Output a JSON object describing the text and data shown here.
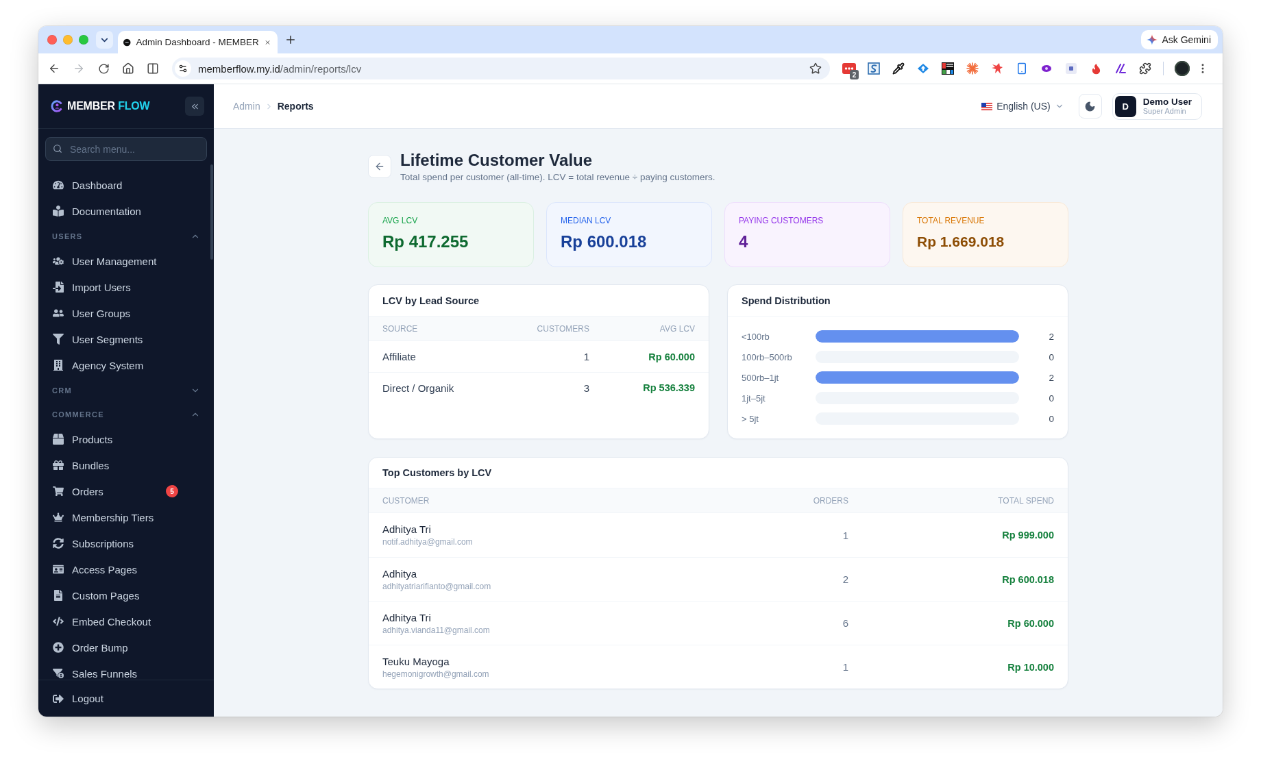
{
  "browser": {
    "tab_title": "Admin Dashboard - MEMBER",
    "forward_button": {
      "disabled": true
    },
    "url": {
      "host": "memberflow.my.id",
      "path": "/admin/reports/lcv"
    },
    "extension_badge": "2",
    "gemini_button": "Ask Gemini"
  },
  "sidebar": {
    "brand": {
      "name": "MEMBER",
      "accent": "FLOW"
    },
    "search": {
      "placeholder": "Search menu..."
    },
    "sections": [
      {
        "items": [
          {
            "label": "Dashboard",
            "selected": false
          },
          {
            "label": "Documentation",
            "selected": false
          }
        ]
      },
      {
        "heading": "USERS",
        "expanded": true,
        "items": [
          {
            "label": "User Management",
            "selected": false
          },
          {
            "label": "Import Users",
            "selected": false
          },
          {
            "label": "User Groups",
            "selected": false
          },
          {
            "label": "User Segments",
            "selected": false
          },
          {
            "label": "Agency System",
            "selected": false
          }
        ]
      },
      {
        "heading": "CRM",
        "expanded": false
      },
      {
        "heading": "COMMERCE",
        "expanded": true,
        "items": [
          {
            "label": "Products",
            "selected": false
          },
          {
            "label": "Bundles",
            "selected": false
          },
          {
            "label": "Orders",
            "selected": false,
            "badge": "5"
          },
          {
            "label": "Membership Tiers",
            "selected": false
          },
          {
            "label": "Subscriptions",
            "selected": false
          },
          {
            "label": "Access Pages",
            "selected": false
          },
          {
            "label": "Custom Pages",
            "selected": false
          },
          {
            "label": "Embed Checkout",
            "selected": false
          },
          {
            "label": "Order Bump",
            "selected": false
          },
          {
            "label": "Sales Funnels",
            "selected": false
          }
        ]
      }
    ],
    "footer": {
      "label": "Logout"
    }
  },
  "header": {
    "breadcrumb": [
      {
        "label": "Admin",
        "current": false
      },
      {
        "label": "Reports",
        "current": true
      }
    ],
    "language": "English (US)",
    "user": {
      "initial": "D",
      "name": "Demo User",
      "role": "Super Admin"
    }
  },
  "page": {
    "title": "Lifetime Customer Value",
    "subtitle": "Total spend per customer (all-time). LCV = total revenue ÷ paying customers."
  },
  "stats": [
    {
      "label": "AVG LCV",
      "value": "Rp 417.255",
      "color": "#16a34a"
    },
    {
      "label": "MEDIAN LCV",
      "value": "Rp 600.018",
      "color": "#2563eb"
    },
    {
      "label": "PAYING CUSTOMERS",
      "value": "4",
      "color": "#9333ea"
    },
    {
      "label": "TOTAL REVENUE",
      "value": "Rp 1.669.018",
      "color": "#d97706"
    }
  ],
  "lead_source": {
    "title": "LCV by Lead Source",
    "columns": [
      "SOURCE",
      "CUSTOMERS",
      "AVG LCV"
    ],
    "rows": [
      {
        "source": "Affiliate",
        "customers": "1",
        "avg_lcv": "Rp 60.000"
      },
      {
        "source": "Direct / Organik",
        "customers": "3",
        "avg_lcv": "Rp 536.339"
      }
    ]
  },
  "spend_distribution": {
    "title": "Spend Distribution",
    "rows": [
      {
        "label": "<100rb",
        "level": 1,
        "count": "2"
      },
      {
        "label": "100rb–500rb",
        "level": 0,
        "count": "0"
      },
      {
        "label": "500rb–1jt",
        "level": 1,
        "count": "2"
      },
      {
        "label": "1jt–5jt",
        "level": 0,
        "count": "0"
      },
      {
        "label": "> 5jt",
        "level": 0,
        "count": "0"
      }
    ]
  },
  "top_customers": {
    "title": "Top Customers by LCV",
    "columns": [
      "CUSTOMER",
      "ORDERS",
      "TOTAL SPEND"
    ],
    "rows": [
      {
        "name": "Adhitya Tri",
        "email": "notif.adhitya@gmail.com",
        "orders": "1",
        "total_spend": "Rp 999.000"
      },
      {
        "name": "Adhitya",
        "email": "adhityatriarifianto@gmail.com",
        "orders": "2",
        "total_spend": "Rp 600.018"
      },
      {
        "name": "Adhitya Tri",
        "email": "adhitya.vianda11@gmail.com",
        "orders": "6",
        "total_spend": "Rp 60.000"
      },
      {
        "name": "Teuku Mayoga",
        "email": "hegemonigrowth@gmail.com",
        "orders": "1",
        "total_spend": "Rp 10.000"
      }
    ]
  }
}
